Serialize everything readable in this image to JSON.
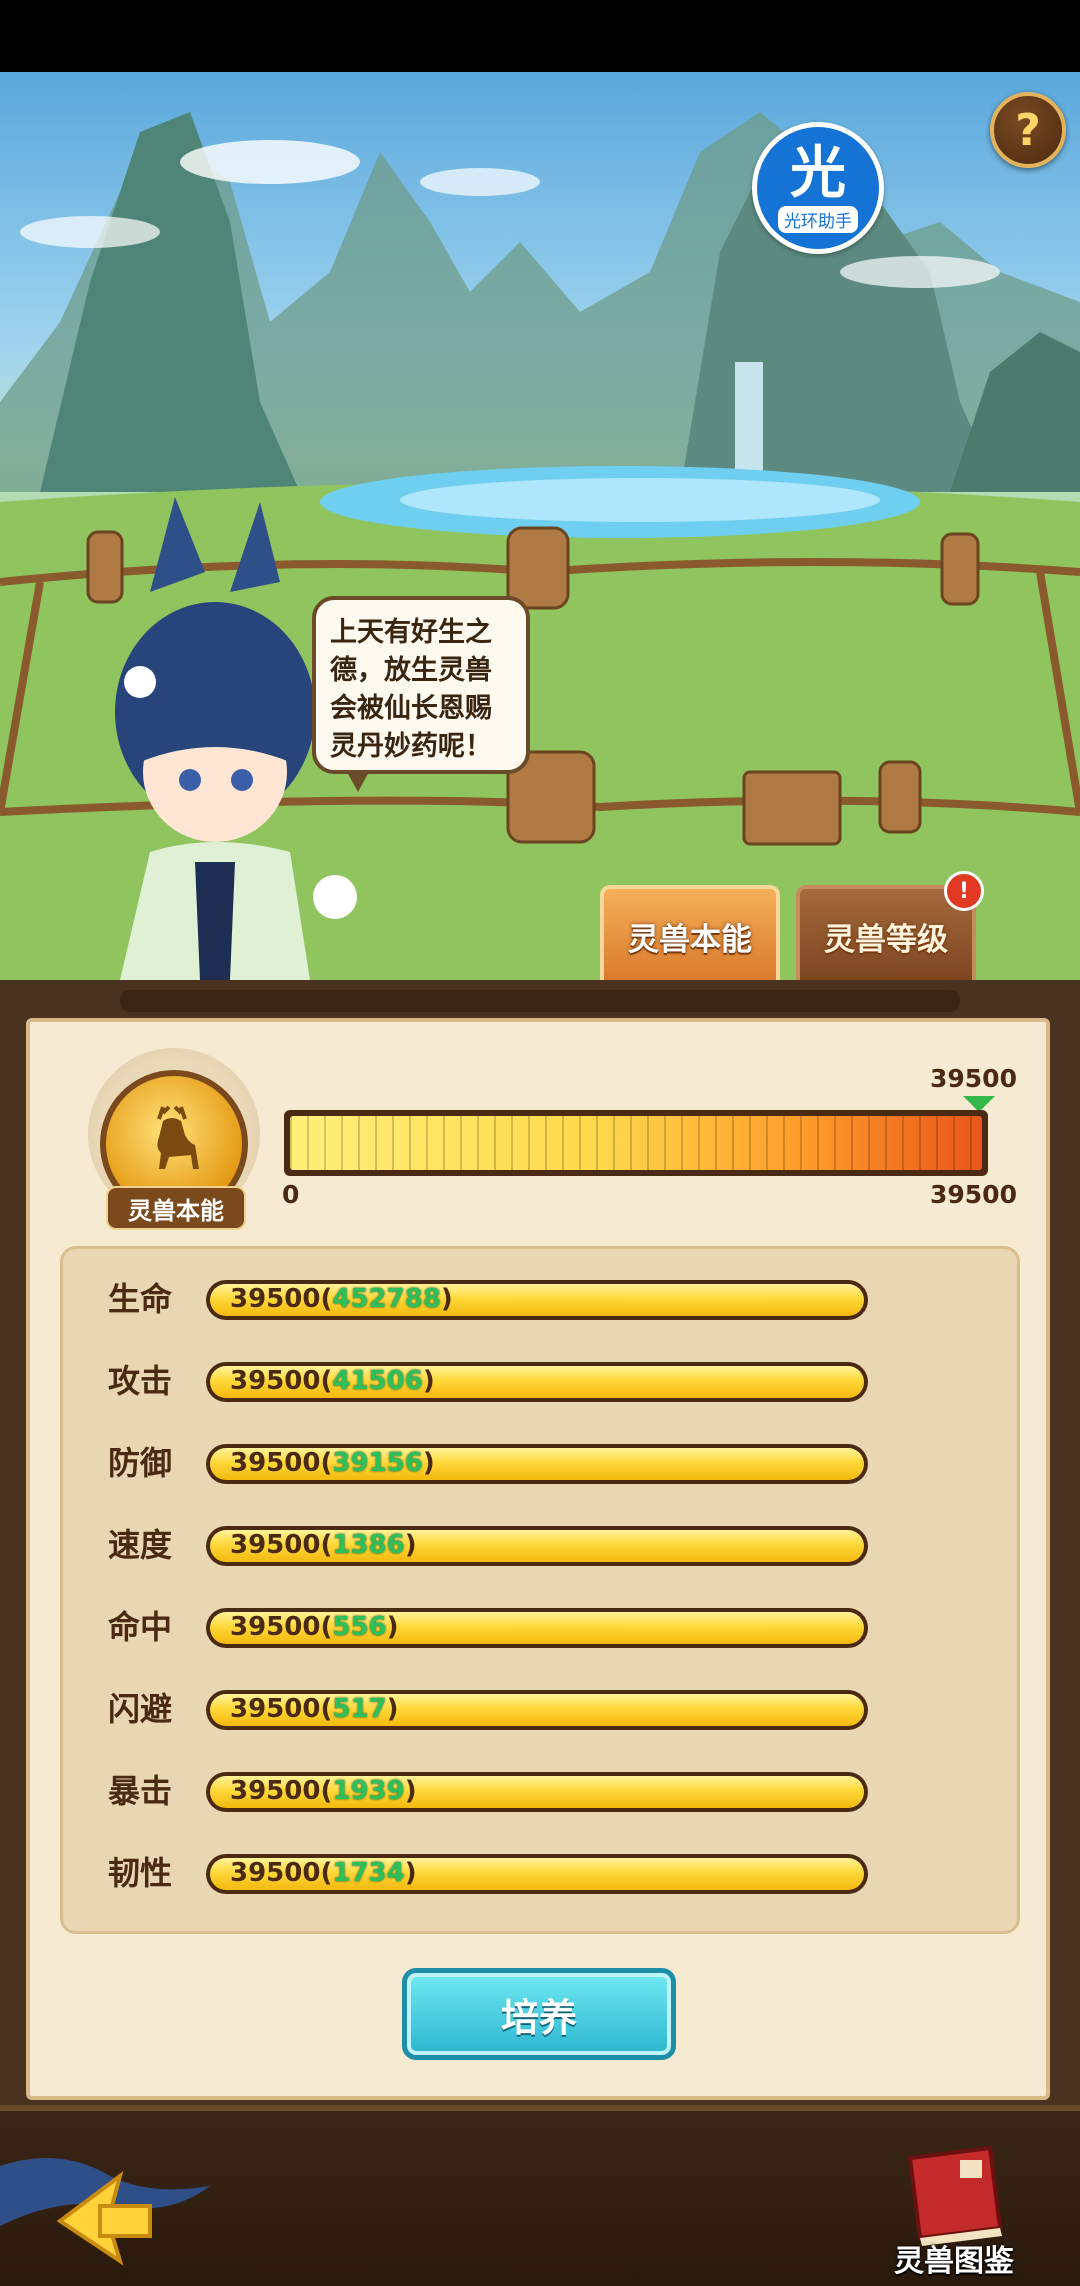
{
  "scene": {
    "speech_bubble_text": "上天有好生之德，放生灵兽会被仙长恩赐灵丹妙药呢！",
    "assist_badge": {
      "glyph": "光",
      "label": "光环助手"
    },
    "help_label": "?"
  },
  "tabs": [
    {
      "label": "灵兽本能",
      "active": true
    },
    {
      "label": "灵兽等级",
      "active": false,
      "alert": "!"
    }
  ],
  "instinct": {
    "emblem_label": "灵兽本能",
    "progress_min": "0",
    "progress_max": "39500",
    "progress_current": "39500",
    "progress_fraction": 1.0
  },
  "stats": [
    {
      "name": "生命",
      "value": "39500",
      "bonus": "452788",
      "fill_fraction": 1.0
    },
    {
      "name": "攻击",
      "value": "39500",
      "bonus": "41506",
      "fill_fraction": 1.0
    },
    {
      "name": "防御",
      "value": "39500",
      "bonus": "39156",
      "fill_fraction": 1.0
    },
    {
      "name": "速度",
      "value": "39500",
      "bonus": "1386",
      "fill_fraction": 1.0
    },
    {
      "name": "命中",
      "value": "39500",
      "bonus": "556",
      "fill_fraction": 1.0
    },
    {
      "name": "闪避",
      "value": "39500",
      "bonus": "517",
      "fill_fraction": 1.0
    },
    {
      "name": "暴击",
      "value": "39500",
      "bonus": "1939",
      "fill_fraction": 1.0
    },
    {
      "name": "韧性",
      "value": "39500",
      "bonus": "1734",
      "fill_fraction": 1.0
    }
  ],
  "actions": {
    "cultivate_label": "培养",
    "codex_label": "灵兽图鉴"
  },
  "colors": {
    "accent_cyan": "#2bb6cf",
    "bonus_green": "#2fbf5a",
    "bar_gold": "#ffd83a",
    "frame_brown": "#4a3220"
  }
}
